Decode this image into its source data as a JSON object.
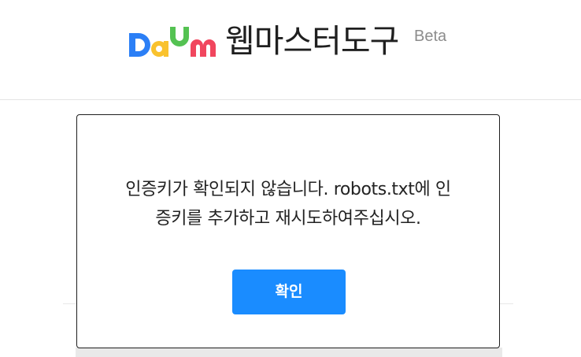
{
  "header": {
    "logo_text": "Daum",
    "service_title": "웹마스터도구",
    "beta_label": "Beta"
  },
  "dialog": {
    "message_line1": "인증키가 확인되지 않습니다. robots.txt에 인",
    "message_line2": "증키를 추가하고 재시도하여주십시오.",
    "confirm_label": "확인"
  },
  "colors": {
    "confirm_button": "#1a8cff",
    "logo_blue": "#2b7ff6",
    "logo_yellow": "#f9c22e",
    "logo_green": "#54c252",
    "logo_red": "#f1465e"
  }
}
